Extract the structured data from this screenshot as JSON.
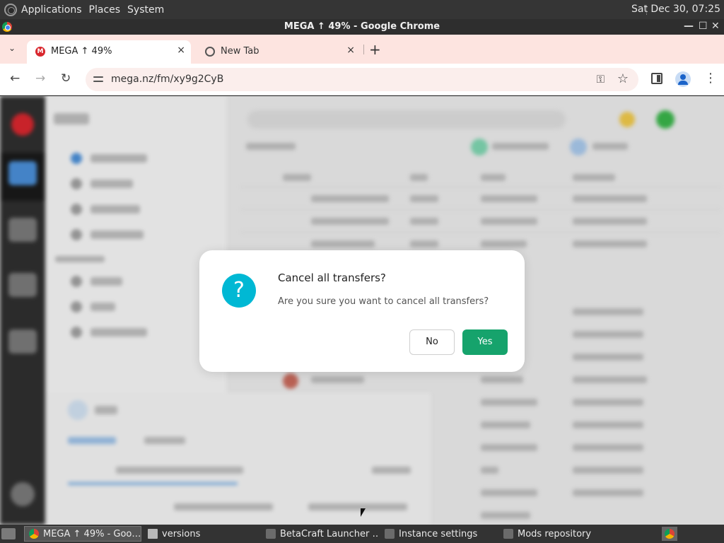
{
  "system_panel": {
    "menus": [
      "Applications",
      "Places",
      "System"
    ],
    "clock": "Sat Dec 30, 07:25"
  },
  "window": {
    "title": "MEGA ↑ 49% - Google Chrome",
    "controls": {
      "minimize": "—",
      "maximize": "☐",
      "close": "✕"
    }
  },
  "tabs": [
    {
      "label": "MEGA ↑ 49%",
      "favicon": "M",
      "active": true
    },
    {
      "label": "New Tab",
      "active": false
    }
  ],
  "toolbar": {
    "url": "mega.nz/fm/xy9g2CyB",
    "back_glyph": "←",
    "forward_glyph": "→",
    "reload_glyph": "↻",
    "new_tab_glyph": "+",
    "tab_close_glyph": "×",
    "tab_menu_glyph": "⌄",
    "more_glyph": "⋮",
    "key_glyph": "⚿",
    "star_glyph": "☆"
  },
  "dialog": {
    "icon_glyph": "?",
    "title": "Cancel all transfers?",
    "message": "Are you sure you want to cancel all transfers?",
    "no_label": "No",
    "yes_label": "Yes"
  },
  "taskbar": {
    "items": [
      {
        "label": "MEGA ↑ 49% - Goo…",
        "icon": "chrome-icon",
        "active": true
      },
      {
        "label": "versions",
        "icon": "folder-icon",
        "active": false
      },
      {
        "label": "BetaCraft Launcher …",
        "icon": "betacraft-icon",
        "active": false
      },
      {
        "label": "Instance settings",
        "icon": "betacraft-icon",
        "active": false
      },
      {
        "label": "Mods repository",
        "icon": "betacraft-icon",
        "active": false
      }
    ]
  },
  "colors": {
    "accent_yes": "#16a36c",
    "dialog_icon": "#00b8d4",
    "mega_red": "#d9272e",
    "tab_strip": "#fde4e0"
  }
}
